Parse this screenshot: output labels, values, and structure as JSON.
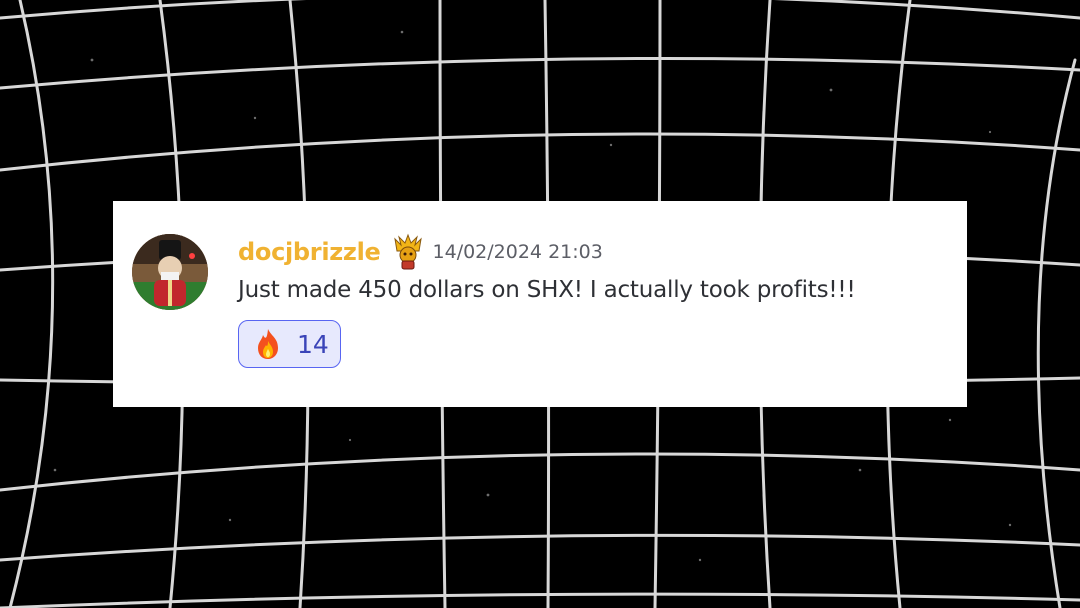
{
  "message": {
    "username": "docjbrizzle",
    "role_icon": "golden-trophy-character-icon",
    "timestamp": "14/02/2024 21:03",
    "text": "Just made 450 dollars on SHX! I actually took profits!!!",
    "avatar": "nutcracker-avatar"
  },
  "reaction": {
    "emoji": "fire-icon",
    "count": "14"
  },
  "colors": {
    "background": "#000000",
    "grid_lines": "#d8d8d8",
    "card": "#ffffff",
    "username": "#f0b232",
    "timestamp": "#5c5e66",
    "text": "#2e3035",
    "reaction_border": "#5865f2",
    "reaction_bg": "#e7e9fd",
    "reaction_count": "#3a44b8"
  }
}
